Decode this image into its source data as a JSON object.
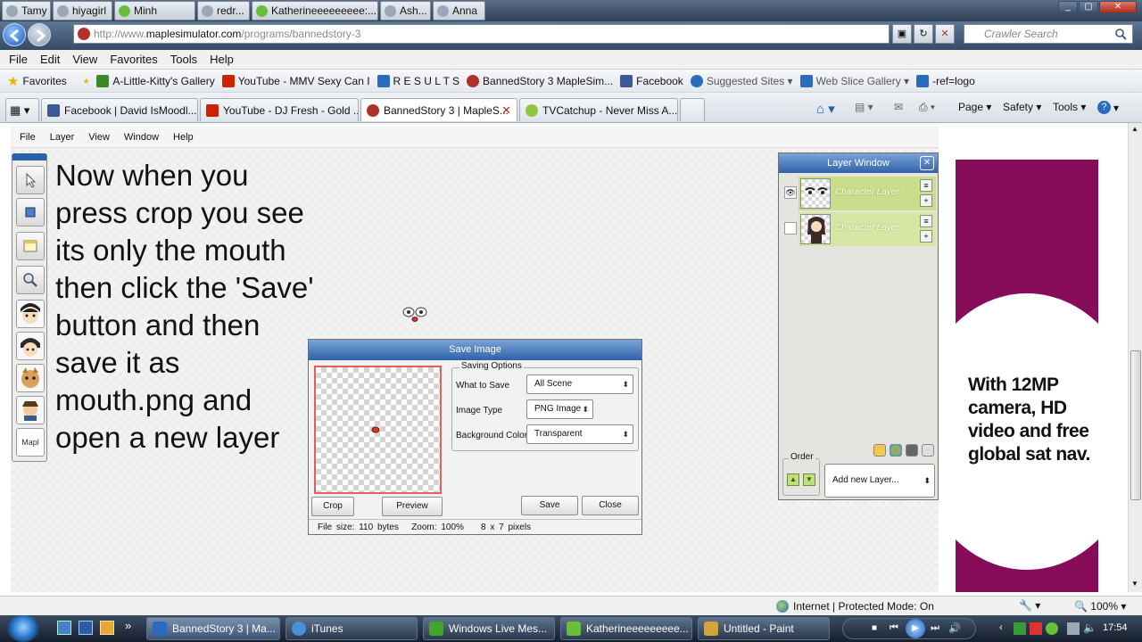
{
  "contacts": {
    "tabs": [
      "Tamy",
      "hiyagirl",
      "Minh",
      "redr...",
      "Katherineeeeeeeee:...",
      "Ash...",
      "Anna"
    ],
    "controls": [
      "_",
      "▢",
      "✕"
    ]
  },
  "address_bar": {
    "url_prefix": "http://www.",
    "url_domain": "maplesimulator.com",
    "url_path": "/programs/bannedstory-3",
    "search_placeholder": "Crawler Search"
  },
  "menu": [
    "File",
    "Edit",
    "View",
    "Favorites",
    "Tools",
    "Help"
  ],
  "favorites_bar": {
    "label": "Favorites",
    "items": [
      {
        "label": "A-Little-Kitty's Gallery",
        "icon": "page-icon",
        "color": "#3a8a2a"
      },
      {
        "label": "YouTube - MMV Sexy Can I",
        "icon": "youtube-icon",
        "color": "#cc2200"
      },
      {
        "label": "R E S U L T S",
        "icon": "ie-page-icon",
        "color": "#2a6bbd"
      },
      {
        "label": "BannedStory 3  MapleSim...",
        "icon": "maple-icon",
        "color": "#b0302a"
      },
      {
        "label": "Facebook",
        "icon": "facebook-icon",
        "color": "#3b5998"
      },
      {
        "label": "Suggested Sites ▾",
        "icon": "ie-suggest-icon",
        "color": "#2a6bbd",
        "dim": true
      },
      {
        "label": "Web Slice Gallery ▾",
        "icon": "ie-page-icon",
        "color": "#2a6bbd",
        "dim": true
      },
      {
        "label": "-ref=logo",
        "icon": "ie-page-icon",
        "color": "#2a6bbd"
      }
    ]
  },
  "browser_tabs": [
    {
      "label": "Facebook | David IsMoodl...",
      "icon_color": "#3b5998"
    },
    {
      "label": "YouTube - DJ Fresh - Gold ...",
      "icon_color": "#cc2200"
    },
    {
      "label": "BannedStory 3 | MapleS...",
      "icon_color": "#b0302a",
      "active": true
    },
    {
      "label": "TVCatchup - Never Miss A...",
      "icon_color": "#8dc63f"
    }
  ],
  "command_bar": [
    "Page ▾",
    "Safety ▾",
    "Tools ▾"
  ],
  "app": {
    "menu": [
      "File",
      "Layer",
      "View",
      "Window",
      "Help"
    ],
    "instruction": "Now when you press crop you see its only the mouth then click the 'Save' button and then save it as mouth.png and open a new layer",
    "save_dialog": {
      "title": "Save Image",
      "group": "Saving Options",
      "fields": [
        {
          "label": "What to Save",
          "value": "All Scene"
        },
        {
          "label": "Image Type",
          "value": "PNG Image"
        },
        {
          "label": "Background Color",
          "value": "Transparent"
        }
      ],
      "buttons": {
        "crop": "Crop",
        "preview": "Preview",
        "save": "Save",
        "close": "Close"
      },
      "status": {
        "file_size": "File size: 110 bytes",
        "zoom": "Zoom: 100%",
        "dims": "8 x 7 pixels"
      }
    },
    "layer_window": {
      "title": "Layer Window",
      "layers": [
        {
          "name": "Character Layer",
          "visible": true
        },
        {
          "name": "Character Layer",
          "visible": false
        }
      ],
      "order_label": "Order",
      "add_layer": "Add new Layer..."
    },
    "ad": {
      "text": "With 12MP camera, HD video and free global sat nav.",
      "bg": "#860b58"
    }
  },
  "status_bar": {
    "zone": "Internet | Protected Mode: On",
    "zoom": "100%"
  },
  "taskbar": {
    "tasks": [
      {
        "label": "BannedStory 3 | Ma...",
        "icon_color": "#2a6bbd",
        "active": true
      },
      {
        "label": "iTunes",
        "icon_color": "#4a90d9"
      },
      {
        "label": "Windows Live Mes...",
        "icon_color": "#46a32a"
      },
      {
        "label": "Katherineeeeeeeee...",
        "icon_color": "#6abf3a"
      },
      {
        "label": "Untitled - Paint",
        "icon_color": "#d4a33a"
      }
    ],
    "clock": "17:54"
  }
}
